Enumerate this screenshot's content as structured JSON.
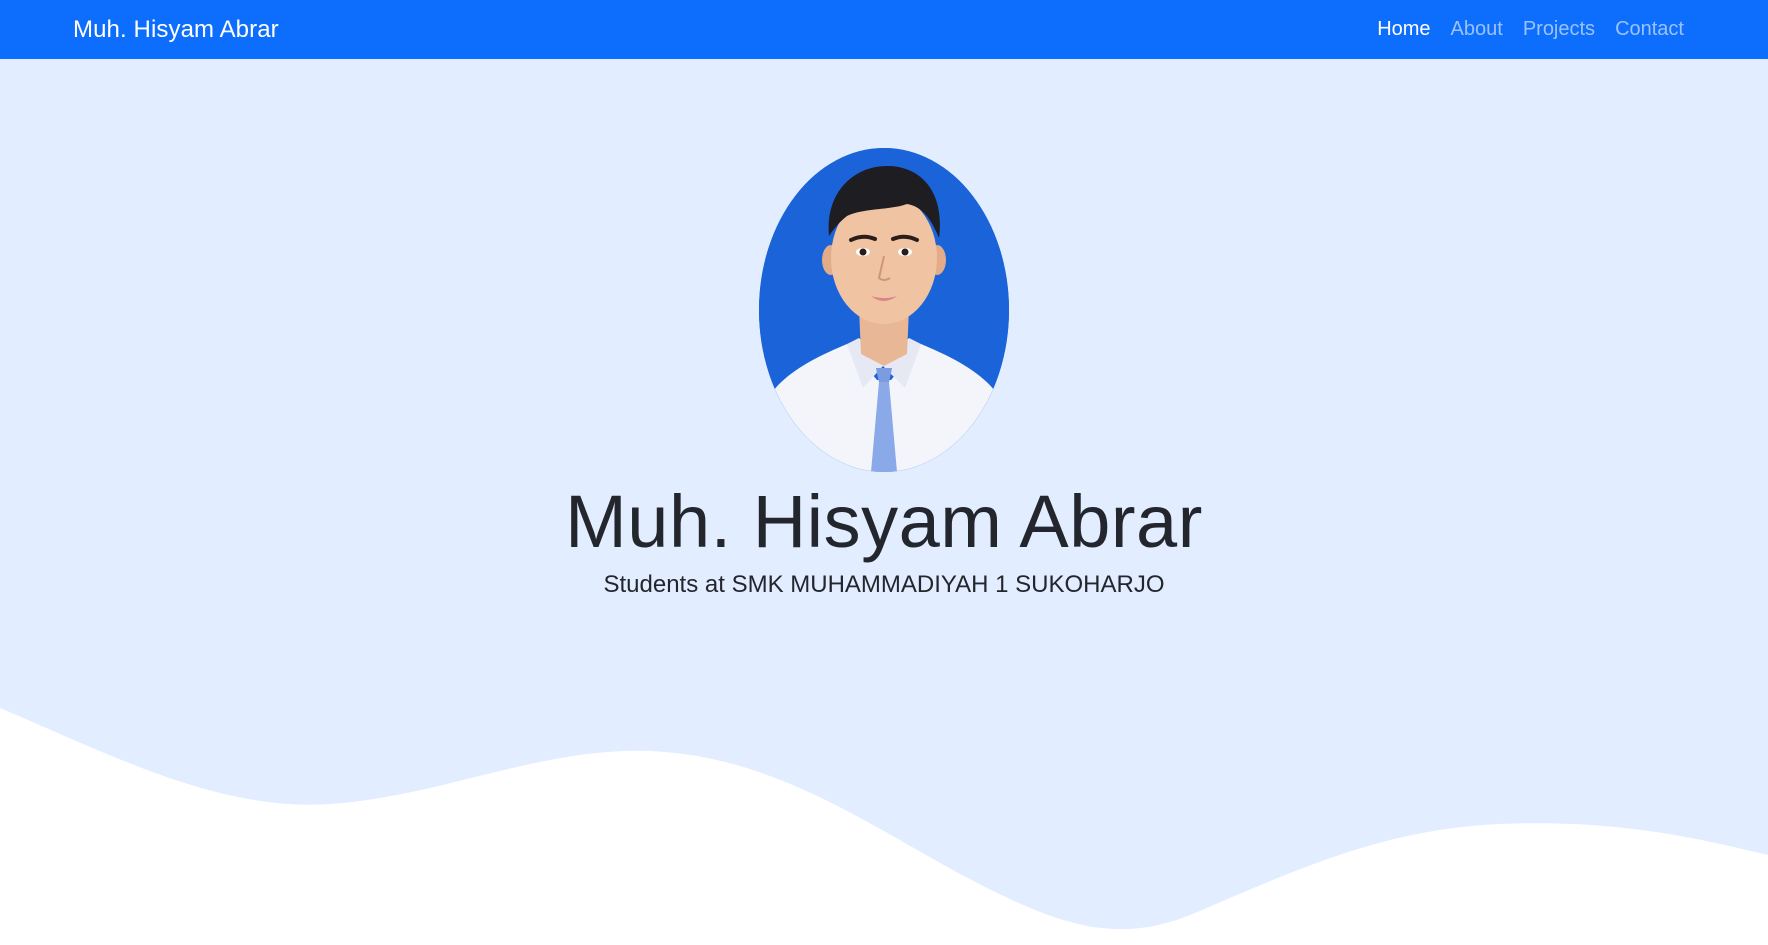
{
  "navbar": {
    "brand": "Muh. Hisyam Abrar",
    "links": [
      {
        "label": "Home",
        "active": true
      },
      {
        "label": "About",
        "active": false
      },
      {
        "label": "Projects",
        "active": false
      },
      {
        "label": "Contact",
        "active": false
      }
    ]
  },
  "hero": {
    "name": "Muh. Hisyam Abrar",
    "subtitle": "Students at SMK MUHAMMADIYAH 1 SUKOHARJO"
  },
  "colors": {
    "navbar_bg": "#0d6efd",
    "hero_bg": "#e2edff",
    "wave_fill": "#ffffff",
    "portrait_bg": "#1b63d8"
  }
}
